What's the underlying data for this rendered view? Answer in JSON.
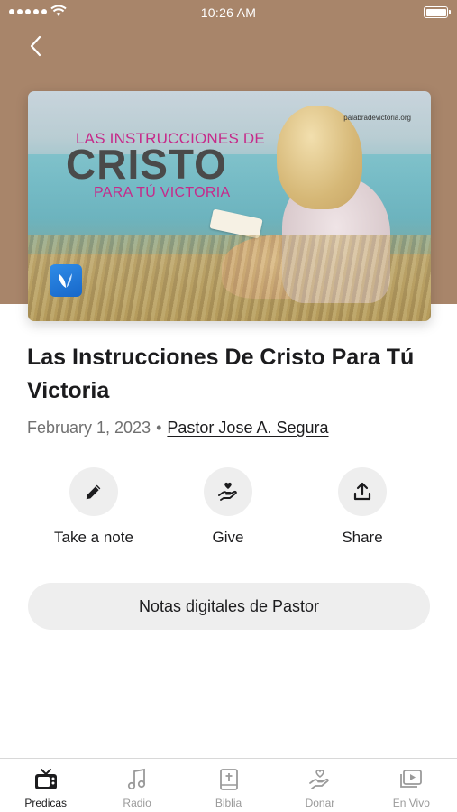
{
  "status_bar": {
    "time": "10:26 AM"
  },
  "artwork": {
    "line1": "LAS INSTRUCCIONES DE",
    "line2": "CRISTO",
    "line3": "PARA TÚ VICTORIA",
    "website": "palabradevictoria.org"
  },
  "sermon": {
    "title": "Las Instrucciones De Cristo Para Tú Victoria",
    "date": "February 1, 2023",
    "separator": "•",
    "author": "Pastor Jose A. Segura"
  },
  "actions": [
    {
      "label": "Take a note",
      "icon": "pencil-icon"
    },
    {
      "label": "Give",
      "icon": "hand-heart-icon"
    },
    {
      "label": "Share",
      "icon": "share-icon"
    }
  ],
  "notes_button": {
    "label": "Notas digitales de Pastor"
  },
  "tabs": [
    {
      "label": "Predicas",
      "icon": "tv-icon",
      "active": true
    },
    {
      "label": "Radio",
      "icon": "music-note-icon",
      "active": false
    },
    {
      "label": "Biblia",
      "icon": "bible-icon",
      "active": false
    },
    {
      "label": "Donar",
      "icon": "hand-heart-icon",
      "active": false
    },
    {
      "label": "En Vivo",
      "icon": "video-library-icon",
      "active": false
    }
  ],
  "colors": {
    "header_background": "#a8856a",
    "accent_magenta": "#c62a8a",
    "active_tab": "#1c1c1e",
    "inactive_tab": "#9a9a9a"
  }
}
